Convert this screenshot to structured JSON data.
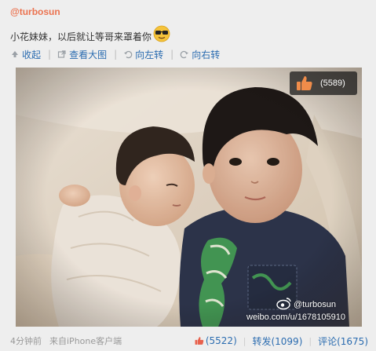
{
  "post": {
    "author": "@turbosun",
    "text": "小花妹妹，以后就让等哥来罩着你",
    "emoji": "cool-sunglasses-emoji"
  },
  "toolbar": {
    "collapse": "收起",
    "view_large": "查看大图",
    "rotate_left": "向左转",
    "rotate_right": "向右转"
  },
  "photo": {
    "like_count": "(5589)",
    "watermark_user": "@turbosun",
    "watermark_url": "weibo.com/u/1678105910"
  },
  "footer": {
    "time": "4分钟前",
    "source_prefix": "来自",
    "source_app": "iPhone客户端",
    "likes": "(5522)",
    "repost": "转发(1099)",
    "comment": "评论(1675)"
  },
  "colors": {
    "author": "#eb7350",
    "link": "#2b6cb0",
    "background": "#eeeeee"
  }
}
